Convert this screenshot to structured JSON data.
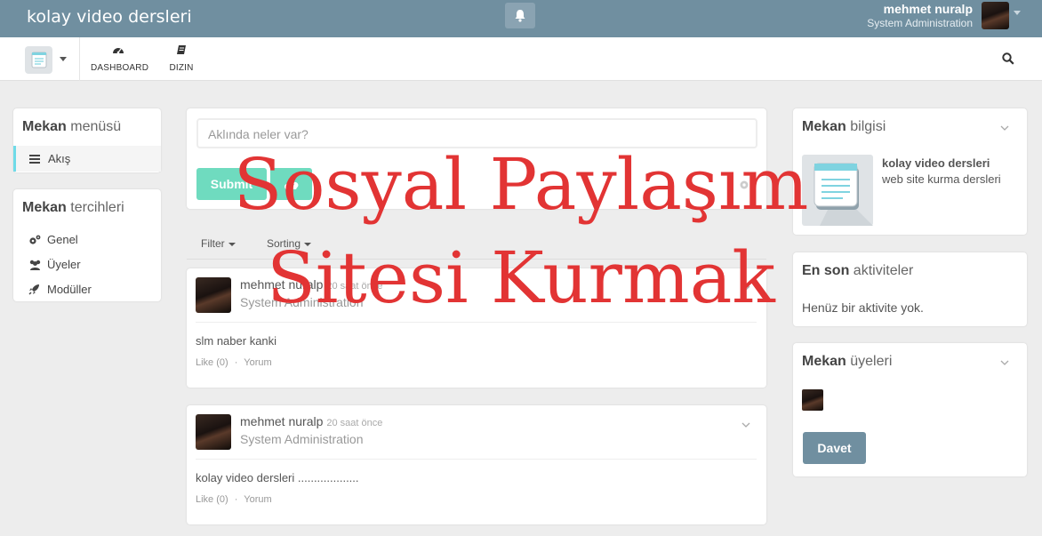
{
  "app": {
    "title": "kolay video dersleri"
  },
  "header": {
    "user_name": "mehmet nuralp",
    "user_role": "System Administration"
  },
  "nav": {
    "items": [
      {
        "label": "DASHBOARD",
        "icon": "dashboard-icon"
      },
      {
        "label": "DIZIN",
        "icon": "book-icon"
      }
    ]
  },
  "left": {
    "menu_title_bold": "Mekan",
    "menu_title_light": "menüsü",
    "menu_items": [
      {
        "label": "Akış",
        "icon": "bars-icon"
      }
    ],
    "prefs_title_bold": "Mekan",
    "prefs_title_light": "tercihleri",
    "prefs_items": [
      {
        "label": "Genel",
        "icon": "cogs-icon"
      },
      {
        "label": "Üyeler",
        "icon": "users-icon"
      },
      {
        "label": "Modüller",
        "icon": "rocket-icon"
      }
    ]
  },
  "compose": {
    "placeholder": "Aklında neler var?",
    "submit_label": "Submit"
  },
  "filters": {
    "filter_label": "Filter",
    "sorting_label": "Sorting"
  },
  "posts": [
    {
      "author": "mehmet nuralp",
      "time": "20 saat önce",
      "role": "System Administration",
      "text": "slm naber kanki",
      "like": "Like (0)",
      "sep": "·",
      "comment": "Yorum"
    },
    {
      "author": "mehmet nuralp",
      "time": "20 saat önce",
      "role": "System Administration",
      "text": "kolay video dersleri ...................",
      "like": "Like (0)",
      "sep": "·",
      "comment": "Yorum"
    }
  ],
  "right": {
    "info_title_bold": "Mekan",
    "info_title_light": "bilgisi",
    "space_name": "kolay video dersleri",
    "space_desc": "web site kurma dersleri",
    "activity_title_bold": "En son",
    "activity_title_light": "aktiviteler",
    "activity_empty": "Henüz bir aktivite yok.",
    "members_title_bold": "Mekan",
    "members_title_light": "üyeleri",
    "invite_label": "Davet"
  },
  "overlay": {
    "line1": "Sosyal Paylaşım",
    "line2": "Sitesi Kurmak"
  },
  "colors": {
    "topbar": "#708fa0",
    "accent": "#6fdbbf",
    "active_border": "#6fdbe8",
    "overlay": "#e23434"
  }
}
